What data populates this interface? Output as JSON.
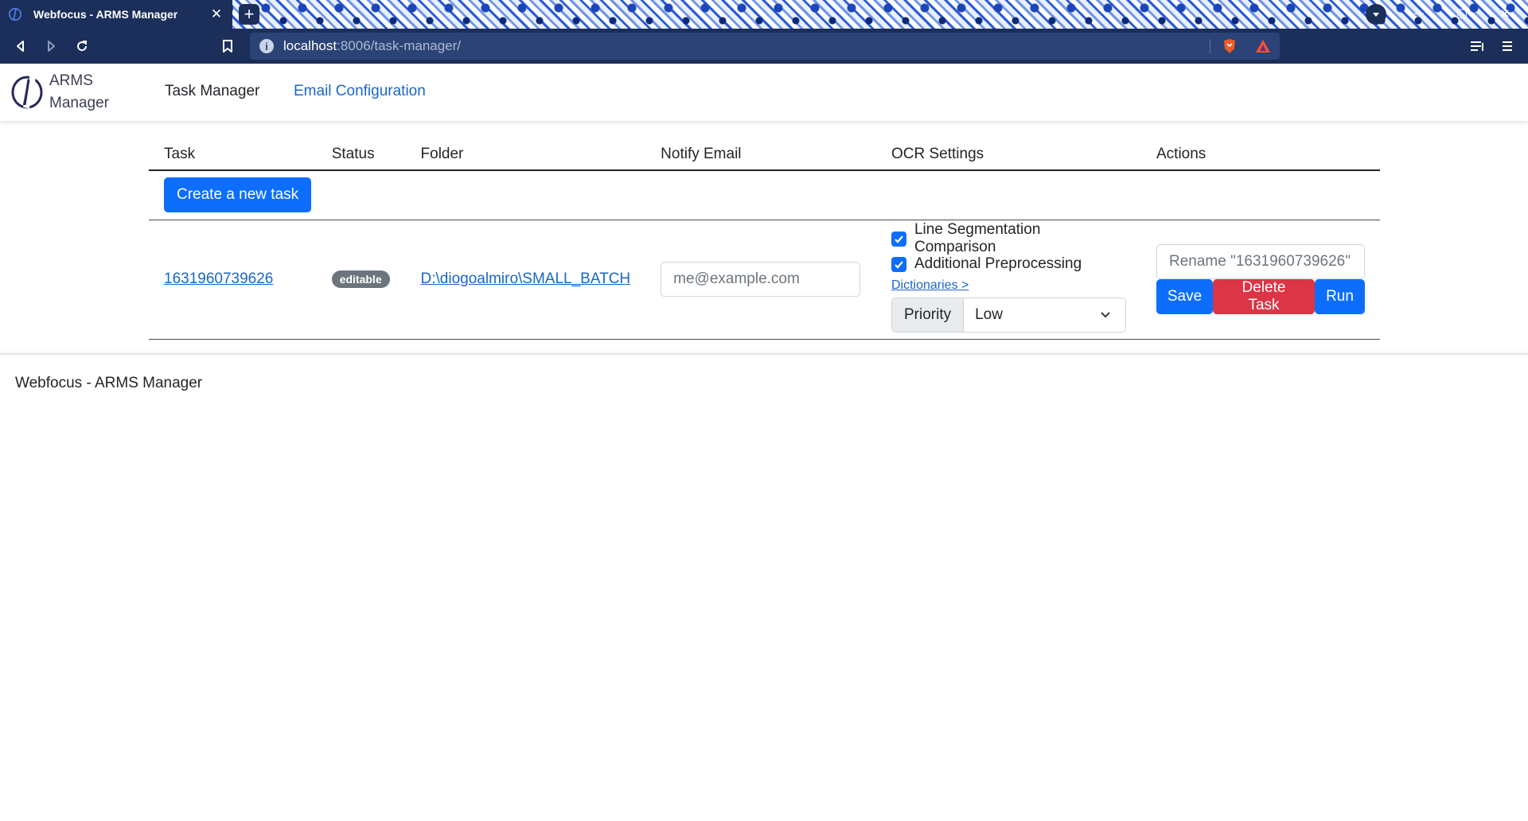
{
  "browser": {
    "tab_title": "Webfocus - ARMS Manager",
    "tab_close": "✕",
    "new_tab": "+",
    "url_host": "localhost",
    "url_rest": ":8006/task-manager/",
    "window_controls": {
      "minimize": "─",
      "maximize": "☐",
      "close": "✕"
    },
    "theme_color": "#1b2f5a"
  },
  "navbar": {
    "brand_line1": "ARMS",
    "brand_line2": "Manager",
    "links": [
      "Task Manager",
      "Email Configuration"
    ],
    "active_link_color": "#1a66c9"
  },
  "table": {
    "headers": [
      "Task",
      "Status",
      "Folder",
      "Notify Email",
      "OCR Settings",
      "Actions"
    ],
    "create_button": "Create a new task",
    "rows": [
      {
        "task_id": "1631960739626",
        "status": "editable",
        "folder": "D:\\diogoalmiro\\SMALL_BATCH",
        "email_placeholder": "me@example.com",
        "email_value": "",
        "ocr": {
          "line_segmentation_label": "Line Segmentation Comparison",
          "line_segmentation_checked": true,
          "preprocessing_label": "Additional Preprocessing",
          "preprocessing_checked": true,
          "dictionaries_link": "Dictionaries >",
          "priority_label": "Priority",
          "priority_value": "Low"
        },
        "actions": {
          "rename_placeholder": "Rename \"1631960739626\"",
          "save": "Save",
          "delete": "Delete Task",
          "run": "Run"
        }
      }
    ]
  },
  "footer": {
    "text": "Webfocus - ARMS Manager"
  },
  "colors": {
    "primary": "#0d6efd",
    "danger": "#dc3545",
    "link": "#1a66c9",
    "badge": "#6c757d"
  }
}
